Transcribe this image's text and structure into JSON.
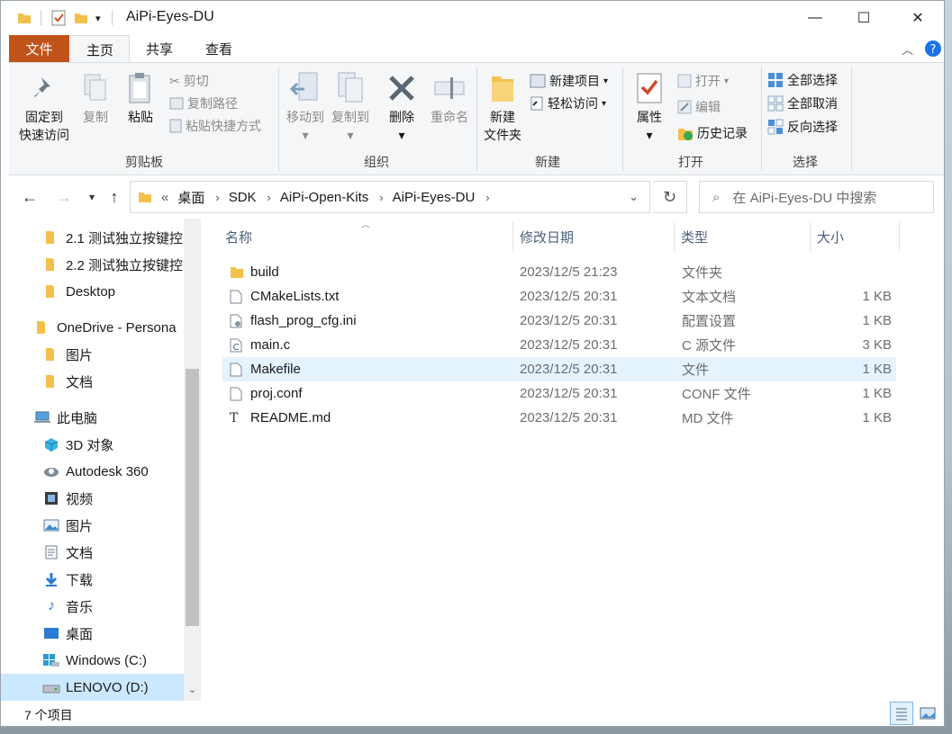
{
  "window": {
    "title": "AiPi-Eyes-DU"
  },
  "ribbon_tabs": [
    "文件",
    "主页",
    "共享",
    "查看"
  ],
  "ribbon": {
    "clipboard": {
      "pin": "固定到\n快速访问",
      "copy": "复制",
      "paste": "粘贴",
      "cut": "剪切",
      "copy_path": "复制路径",
      "paste_shortcut": "粘贴快捷方式",
      "label": "剪贴板"
    },
    "organize": {
      "move_to": "移动到",
      "copy_to": "复制到",
      "delete": "删除",
      "rename": "重命名",
      "label": "组织"
    },
    "new": {
      "new_folder": "新建\n文件夹",
      "new_item": "新建项目",
      "easy_access": "轻松访问",
      "label": "新建"
    },
    "open": {
      "properties": "属性",
      "open": "打开",
      "edit": "编辑",
      "history": "历史记录",
      "label": "打开"
    },
    "select": {
      "select_all": "全部选择",
      "select_none": "全部取消",
      "invert": "反向选择",
      "label": "选择"
    }
  },
  "address": {
    "overflow": "«",
    "crumbs": [
      "桌面",
      "SDK",
      "AiPi-Open-Kits",
      "AiPi-Eyes-DU"
    ],
    "search_placeholder": "在 AiPi-Eyes-DU 中搜索"
  },
  "nav_pane": [
    {
      "label": "2.1 测试独立按键控",
      "icon": "folder-icon"
    },
    {
      "label": "2.2 测试独立按键控",
      "icon": "folder-icon"
    },
    {
      "label": "Desktop",
      "icon": "folder-icon"
    },
    {
      "label": "OneDrive - Persona",
      "icon": "folder-icon"
    },
    {
      "label": "图片",
      "icon": "folder-icon"
    },
    {
      "label": "文档",
      "icon": "folder-icon"
    },
    {
      "label": "此电脑",
      "icon": "computer-icon"
    },
    {
      "label": "3D 对象",
      "icon": "cube-icon"
    },
    {
      "label": "Autodesk 360",
      "icon": "cloud-drive-icon"
    },
    {
      "label": "视频",
      "icon": "video-icon"
    },
    {
      "label": "图片",
      "icon": "pictures-icon"
    },
    {
      "label": "文档",
      "icon": "documents-icon"
    },
    {
      "label": "下载",
      "icon": "download-icon"
    },
    {
      "label": "音乐",
      "icon": "music-icon"
    },
    {
      "label": "桌面",
      "icon": "desktop-icon"
    },
    {
      "label": "Windows (C:)",
      "icon": "windows-drive-icon"
    },
    {
      "label": "LENOVO (D:)",
      "icon": "drive-icon"
    }
  ],
  "columns": {
    "name": "名称",
    "date": "修改日期",
    "type": "类型",
    "size": "大小"
  },
  "files": [
    {
      "name": "build",
      "date": "2023/12/5 21:23",
      "type": "文件夹",
      "size": "",
      "icon": "folder-icon"
    },
    {
      "name": "CMakeLists.txt",
      "date": "2023/12/5 20:31",
      "type": "文本文档",
      "size": "1 KB",
      "icon": "text-file-icon"
    },
    {
      "name": "flash_prog_cfg.ini",
      "date": "2023/12/5 20:31",
      "type": "配置设置",
      "size": "1 KB",
      "icon": "config-file-icon"
    },
    {
      "name": "main.c",
      "date": "2023/12/5 20:31",
      "type": "C 源文件",
      "size": "3 KB",
      "icon": "c-file-icon"
    },
    {
      "name": "Makefile",
      "date": "2023/12/5 20:31",
      "type": "文件",
      "size": "1 KB",
      "icon": "file-icon"
    },
    {
      "name": "proj.conf",
      "date": "2023/12/5 20:31",
      "type": "CONF 文件",
      "size": "1 KB",
      "icon": "file-icon"
    },
    {
      "name": "README.md",
      "date": "2023/12/5 20:31",
      "type": "MD 文件",
      "size": "1 KB",
      "icon": "markdown-file-icon"
    }
  ],
  "status": {
    "count": "7 个项目"
  },
  "colors": {
    "file_tab": "#c0531a",
    "hover_row": "#e5f3ff",
    "selected_nav": "#cce8ff",
    "folder": "#f3c14b"
  }
}
